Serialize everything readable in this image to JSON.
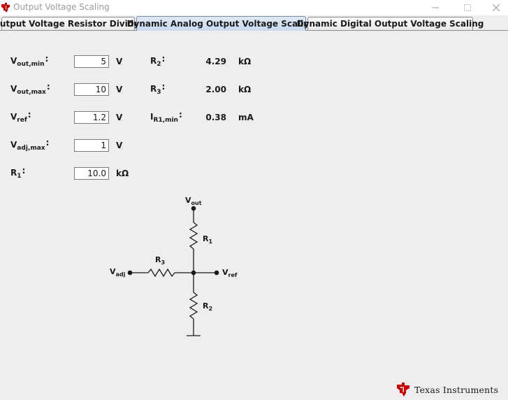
{
  "window": {
    "title": "Output Voltage Scaling",
    "controls": {
      "minimize": "minimize-icon",
      "maximize": "maximize-icon",
      "close": "close-icon"
    }
  },
  "tabs": [
    {
      "label": "Output Voltage Resistor Divider",
      "active": false
    },
    {
      "label": "Dynamic Analog Output Voltage Scaling",
      "active": true
    },
    {
      "label": "Dynamic Digital Output Voltage Scaling",
      "active": false
    }
  ],
  "inputs": [
    {
      "symbol": "V",
      "subscript": "out,min",
      "value": "5",
      "unit": "V"
    },
    {
      "symbol": "V",
      "subscript": "out,max",
      "value": "10",
      "unit": "V"
    },
    {
      "symbol": "V",
      "subscript": "ref",
      "value": "1.2",
      "unit": "V"
    },
    {
      "symbol": "V",
      "subscript": "adj,max",
      "value": "1",
      "unit": "V"
    },
    {
      "symbol": "R",
      "subscript": "1",
      "value": "10.0",
      "unit": "kΩ"
    }
  ],
  "results": [
    {
      "symbol": "R",
      "subscript": "2",
      "value": "4.29",
      "unit": "kΩ"
    },
    {
      "symbol": "R",
      "subscript": "3",
      "value": "2.00",
      "unit": "kΩ"
    },
    {
      "symbol": "I",
      "subscript": "R1,min",
      "value": "0.38",
      "unit": "mA"
    }
  ],
  "colon": ":",
  "schematic": {
    "vout": {
      "symbol": "V",
      "subscript": "out"
    },
    "vadj": {
      "symbol": "V",
      "subscript": "adj"
    },
    "vref": {
      "symbol": "V",
      "subscript": "ref"
    },
    "r1": {
      "symbol": "R",
      "subscript": "1"
    },
    "r2": {
      "symbol": "R",
      "subscript": "2"
    },
    "r3": {
      "symbol": "R",
      "subscript": "3"
    }
  },
  "logo": {
    "text": "Texas Instruments",
    "icon": "ti-logo-icon",
    "accent_color": "#cc0000"
  }
}
